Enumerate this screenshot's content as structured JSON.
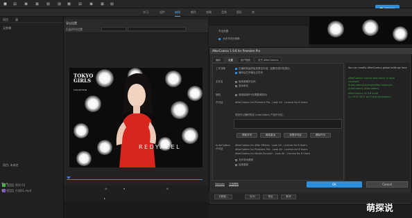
{
  "workspace_tabs": [
    "学习",
    "组件",
    "编辑",
    "颜色",
    "效果",
    "音频",
    "图形",
    "库"
  ],
  "workspace_active_index": 2,
  "left_panel": {
    "tabs": [
      "项目",
      "源"
    ],
    "items": [
      "无剪辑",
      "项目: 未命名"
    ],
    "project_rows": [
      "序列 01",
      "片段01.mp4"
    ]
  },
  "monitor": {
    "title": "导出设置",
    "subtitle": "匹配序列设置"
  },
  "video": {
    "title_line1": "TOKYO",
    "title_line2": "GIRLS",
    "title_line3": "COLLECTION",
    "brand": "REDYAZEL"
  },
  "prefs": {
    "title": "写出设置",
    "item": "允许不同分辨率"
  },
  "dialog": {
    "title": "AfterCodecs 1.9.6 for Premiere Pro",
    "tabs": [
      "编码",
      "设置",
      "用户授权",
      "关于 AfterCodecs"
    ],
    "active_tab": 1,
    "sections": {
      "workflow_label": "工作流程",
      "workflow_opt1": "在编码前始终检查是否可用，如果完成时将提示。",
      "workflow_opt2": "编码后打开输出文件夹",
      "file_label": "文件名",
      "file_opt1": "使用源素材名称",
      "file_opt2": "自动命名",
      "license_label": "授权",
      "license_opt": "离线使用许可(需要授权码)",
      "user_label": "许可证",
      "user_text": "AfterCodecs for Premiere Pro - Look All - License for 8 Users",
      "buy_prompt": "您还可以随时购买 AutoCodecs 产品许可证：",
      "buttons": [
        "获取许可",
        "离线激活",
        "查看许可证",
        "删除许可"
      ],
      "ae_label": "AutoCodecs\n许可证",
      "ae_lines": [
        "AfterCodecs for After Effects - Look All - License for 8 Users",
        "AfterCodecs for Premiere Pro - Look All - License for 8 Users",
        "AfterCodecs for Media Encoder - Look All - License for 8 Users"
      ],
      "ae_opt1": "允许自动更新",
      "ae_opt2": "检查更新"
    },
    "side_log_title": "You can modify AfterCodecs global settings here",
    "side_log_lines": [
      "AfterCodecs license was found in local",
      "Licensed",
      "AutoCodecs\\Licenses\\AfterCodecs.lic",
      "AutoCodecs: AfterCodecs",
      "AfterCodecs v1.9.6 build",
      "(c) 2020 2021 by Fnord developers"
    ],
    "footer_links": [
      "Website",
      "文档帮助"
    ],
    "ok_label": "OK",
    "cancel_label": "Cancel"
  },
  "footer_buttons": [
    "元数据...",
    "队列",
    "导出",
    "取消"
  ],
  "watermark": "萌探说"
}
